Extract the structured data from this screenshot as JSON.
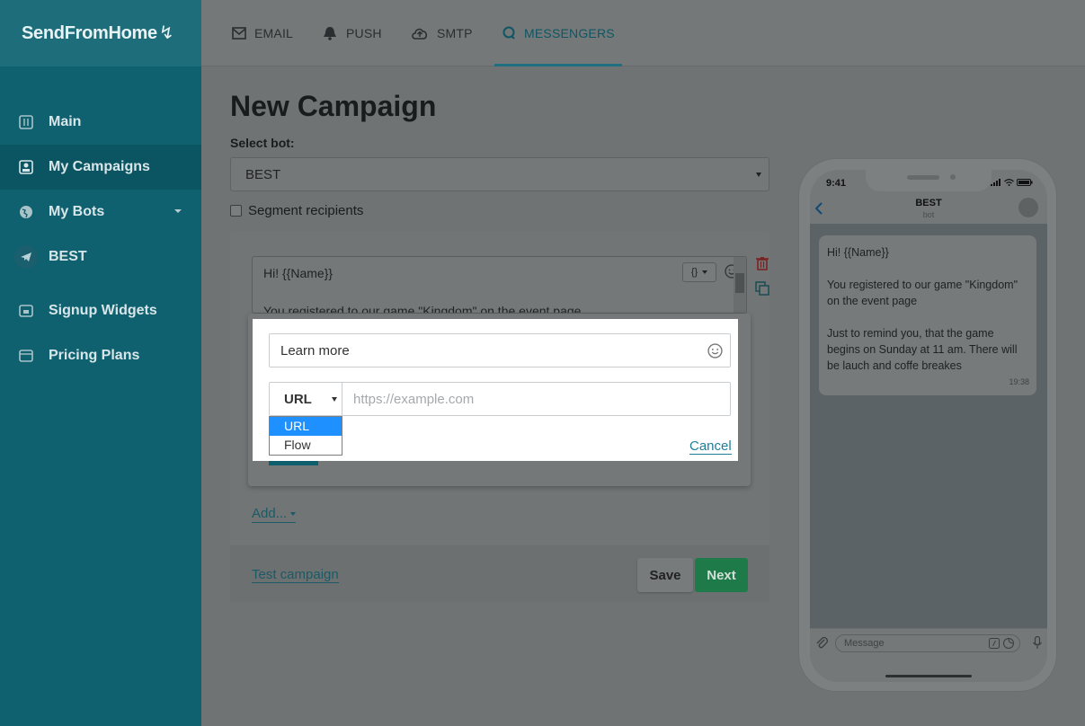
{
  "app": {
    "brand": "SendFromHome"
  },
  "sidebar": {
    "items": [
      {
        "label": "Main",
        "icon": "sliders-icon"
      },
      {
        "label": "My Campaigns",
        "icon": "campaigns-icon"
      },
      {
        "label": "My Bots",
        "icon": "globe-icon"
      },
      {
        "label": "BEST",
        "icon": "telegram-icon"
      },
      {
        "label": "Signup Widgets",
        "icon": "widget-icon"
      },
      {
        "label": "Pricing Plans",
        "icon": "wallet-icon"
      }
    ]
  },
  "topnav": {
    "tabs": [
      {
        "label": "EMAIL",
        "icon": "envelope-icon"
      },
      {
        "label": "PUSH",
        "icon": "bell-icon"
      },
      {
        "label": "SMTP",
        "icon": "cloud-upload-icon"
      },
      {
        "label": "MESSENGERS",
        "icon": "chat-icon",
        "active": true
      }
    ]
  },
  "page": {
    "title": "New Campaign",
    "select_bot_label": "Select bot:",
    "selected_bot": "BEST",
    "segment_label": "Segment recipients"
  },
  "editor": {
    "line1": "Hi! {{Name}}",
    "line2": "You registered to our game \"Kingdom\" on the event page",
    "var_button": "{}"
  },
  "button_popup": {
    "text_value": "Learn more",
    "type_value": "URL",
    "url_placeholder": "https://example.com",
    "type_options": [
      "URL",
      "Flow"
    ],
    "selected_option": "URL",
    "cancel_label": "Cancel"
  },
  "actions": {
    "add_label": "Add...",
    "test_label": "Test campaign",
    "save_label": "Save",
    "next_label": "Next"
  },
  "phone_preview": {
    "time": "9:41",
    "chat_name": "BEST",
    "chat_sub": "bot",
    "message_p1": "Hi! {{Name}}",
    "message_p2": "You registered to our game \"Kingdom\" on the event page",
    "message_p3": "Just to remind you, that the game begins on Sunday at 11 am. There will be lauch and coffe breakes",
    "message_time": "19:38",
    "input_placeholder": "Message"
  },
  "colors": {
    "sidebar": "#0f6170",
    "accent": "#1f6f80",
    "next_button": "#1f7a4a",
    "dropdown_selected": "#1e90ff"
  }
}
